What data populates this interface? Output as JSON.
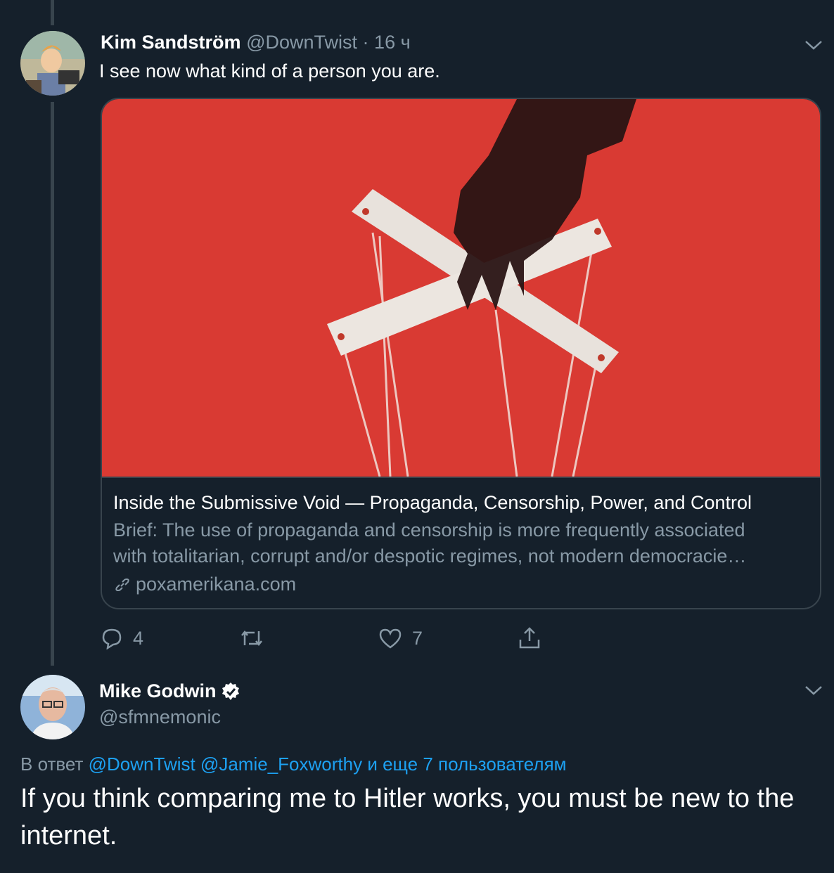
{
  "tweet1": {
    "author_name": "Kim Sandström",
    "handle": "@DownTwist",
    "separator": "·",
    "time": "16 ч",
    "text": "I see now what kind of a person you are.",
    "card": {
      "title": "Inside the Submissive Void — Propaganda, Censorship, Power, and Control",
      "description_line1": "Brief: The use of propaganda and censorship is more frequently associated",
      "description_line2": "with totalitarian, corrupt and/or despotic regimes, not modern democracie…",
      "domain": "poxamerikana.com"
    },
    "actions": {
      "reply_count": "4",
      "retweet_count": "",
      "like_count": "7"
    }
  },
  "tweet2": {
    "author_name": "Mike Godwin",
    "handle": "@sfmnemonic",
    "reply_prefix": "В ответ",
    "reply_to_1": "@DownTwist",
    "reply_to_2": "@Jamie_Foxworthy",
    "reply_suffix": "и еще 7 пользователям",
    "text": "If you think comparing me to Hitler works, you must be new to the internet."
  },
  "colors": {
    "background": "#15202b",
    "muted": "#8899a6",
    "link": "#1da1f2",
    "border": "#38444d",
    "card_image_red": "#d93a33"
  },
  "icons": [
    "reply-icon",
    "retweet-icon",
    "like-icon",
    "share-icon",
    "chevron-down-icon",
    "verified-badge-icon",
    "link-icon"
  ]
}
